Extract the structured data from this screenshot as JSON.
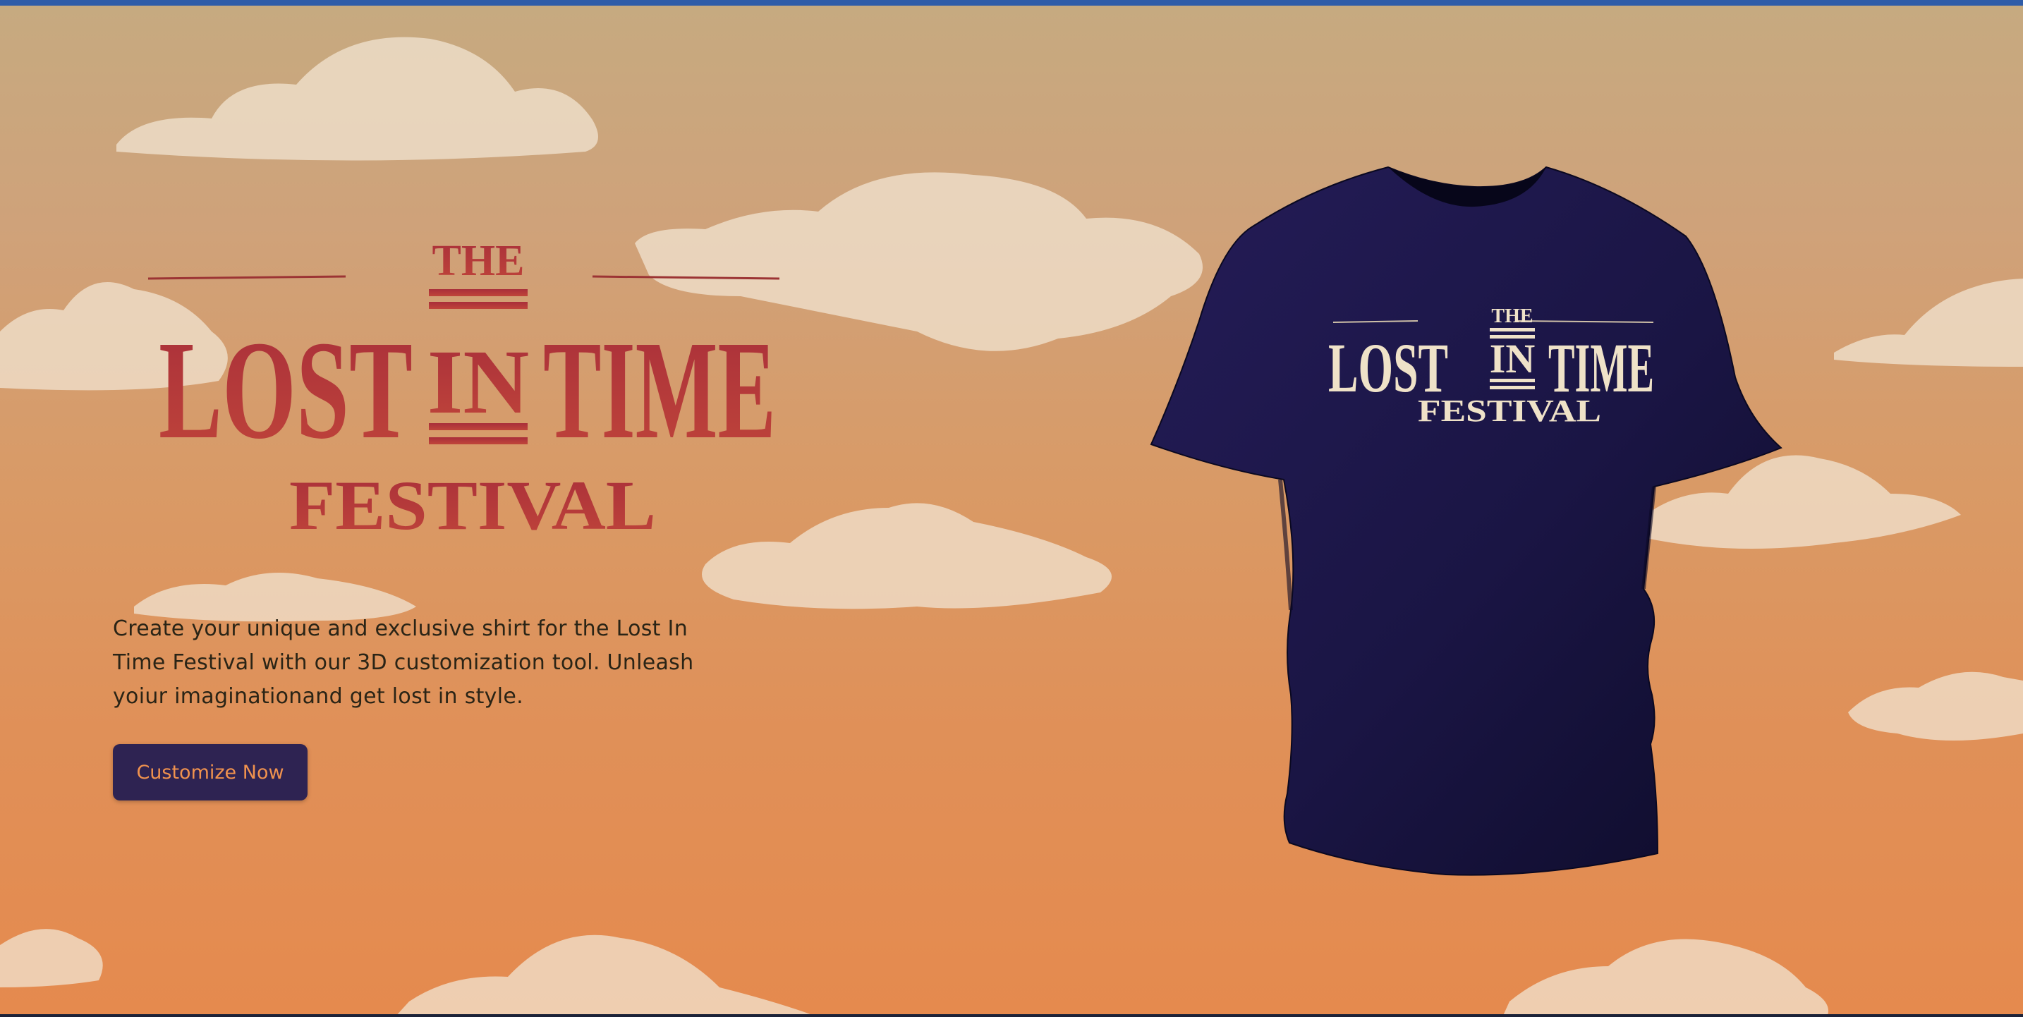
{
  "hero": {
    "logo": {
      "line1": "THE",
      "line2_left": "LOST",
      "line2_mid": "IN",
      "line2_right": "TIME",
      "line3": "FESTIVAL"
    },
    "description": "Create your unique and exclusive shirt for the Lost In Time Festival with our 3D customization tool. Unleash yoiur imaginationand get lost in style.",
    "cta_label": "Customize Now"
  },
  "shirt_print": {
    "line1": "THE",
    "line2_left": "LOST",
    "line2_mid": "IN",
    "line2_right": "TIME",
    "line3": "FESTIVAL"
  },
  "icons": {
    "clouds": "cloud-shapes",
    "shirt": "t-shirt-3d-model"
  },
  "colors": {
    "top_bar": "#2f5ca8",
    "logo_red": "#b23a36",
    "cta_bg": "#2e2352",
    "cta_text": "#f0924e",
    "shirt_navy": "#1b1745",
    "print_cream": "#efe2c8",
    "body_text": "#2a2416"
  }
}
